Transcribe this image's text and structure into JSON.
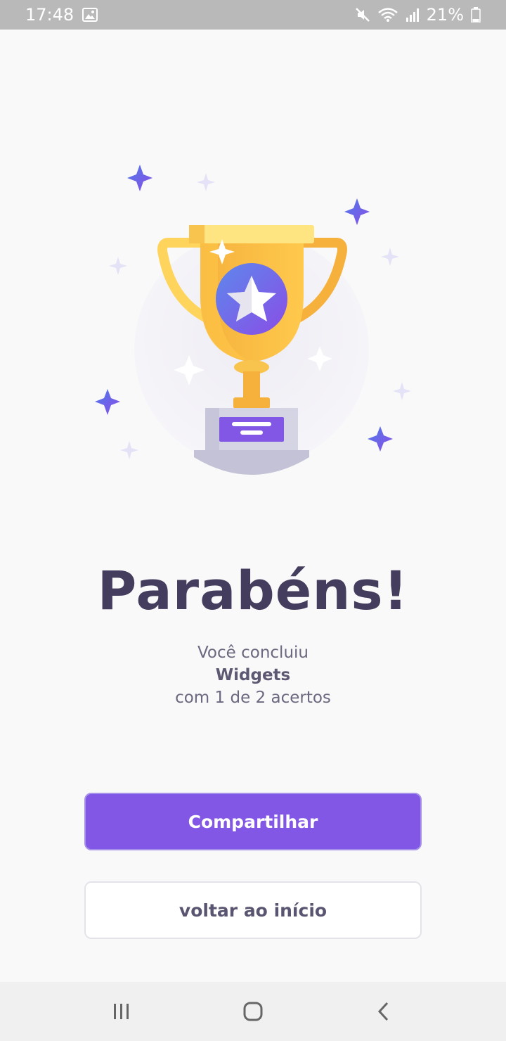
{
  "status_bar": {
    "time": "17:48",
    "battery": "21%",
    "icons": [
      "image-icon",
      "mute-icon",
      "wifi-icon",
      "signal-icon",
      "battery-icon"
    ]
  },
  "illustration": {
    "description_icon": "trophy-icon"
  },
  "content": {
    "title": "Parabéns!",
    "line1": "Você concluiu",
    "subject": "Widgets",
    "result": "com 1 de 2 acertos"
  },
  "buttons": {
    "share_label": "Compartilhar",
    "home_label": "voltar ao início"
  },
  "nav": {
    "icons": [
      "recent-apps-icon",
      "home-icon",
      "back-icon"
    ]
  },
  "colors": {
    "primary": "#8257e5",
    "title": "#453d5e",
    "status_bar": "#b9b9b9"
  }
}
